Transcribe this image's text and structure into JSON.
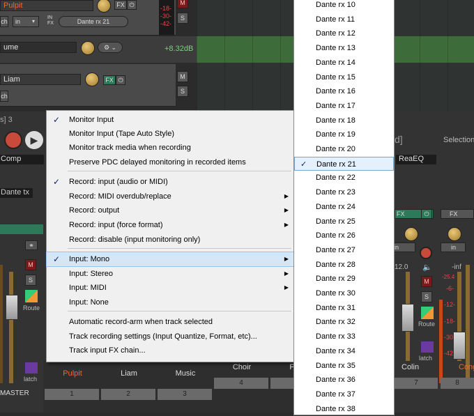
{
  "tracks": {
    "track1_name": "Pulpit",
    "track1_fx": "FX",
    "track1_in": "in",
    "track1_arch": "ch",
    "track1_infx": "IN\nFX",
    "track1_input": "Dante rx 21",
    "track1_meter": [
      "-18-",
      "-30-",
      "-42-"
    ],
    "volume_label": "ume",
    "volume_db": "+8.32dB",
    "track2_name": "Liam",
    "track2_fx": "FX",
    "track2_arch": "ch"
  },
  "ms": {
    "m": "M",
    "s": "S"
  },
  "left_panel": {
    "frag_a": "s] 3",
    "comp": "Comp",
    "dante_tx": "Dante tx",
    "route": "Route",
    "latch": "latch",
    "master": "MASTER"
  },
  "right_panel": {
    "frag_bracket": "d]",
    "selection": "Selection",
    "reaeq": "ReaEQ",
    "fx1": "FX",
    "fx2": "FX",
    "in1": "in",
    "in2": "in",
    "val1": "12.0",
    "val2": "-inf",
    "meter2": [
      "-25.4",
      "-6-",
      "-12-",
      "-18-",
      "-30-",
      "-42-"
    ],
    "route": "Route",
    "latch": "latch",
    "colin": "Colin",
    "cong": "Cong"
  },
  "mixer": {
    "strips": [
      {
        "label": "Pulpit",
        "num": "1",
        "color": "#f06a2a"
      },
      {
        "label": "Liam",
        "num": "2",
        "color": "#dddddd"
      },
      {
        "label": "Music",
        "num": "3",
        "color": "#dddddd"
      },
      {
        "label": "Choir",
        "num": "4",
        "color": "#dddddd"
      },
      {
        "label": "P",
        "num": "",
        "color": "#dddddd"
      },
      {
        "label": "Colin",
        "num": "7",
        "color": "#dddddd"
      },
      {
        "label": "Cong",
        "num": "8",
        "color": "#f06a2a"
      }
    ]
  },
  "context_menu": {
    "items": [
      {
        "label": "Monitor Input",
        "checked": true,
        "submenu": false
      },
      {
        "label": "Monitor Input (Tape Auto Style)",
        "checked": false,
        "submenu": false
      },
      {
        "label": "Monitor track media when recording",
        "checked": false,
        "submenu": false
      },
      {
        "label": "Preserve PDC delayed monitoring in recorded items",
        "checked": false,
        "submenu": false
      },
      {
        "label": "Record: input (audio or MIDI)",
        "checked": true,
        "submenu": false
      },
      {
        "label": "Record: MIDI overdub/replace",
        "checked": false,
        "submenu": true
      },
      {
        "label": "Record: output",
        "checked": false,
        "submenu": true
      },
      {
        "label": "Record: input (force format)",
        "checked": false,
        "submenu": true
      },
      {
        "label": "Record: disable (input monitoring only)",
        "checked": false,
        "submenu": false
      },
      {
        "label": "Input: Mono",
        "checked": true,
        "submenu": true,
        "highlighted": true
      },
      {
        "label": "Input: Stereo",
        "checked": false,
        "submenu": true
      },
      {
        "label": "Input: MIDI",
        "checked": false,
        "submenu": true
      },
      {
        "label": "Input: None",
        "checked": false,
        "submenu": false
      },
      {
        "label": "Automatic record-arm when track selected",
        "checked": false,
        "submenu": false
      },
      {
        "label": "Track recording settings (Input Quantize, Format, etc)...",
        "checked": false,
        "submenu": false
      },
      {
        "label": "Track input FX chain...",
        "checked": false,
        "submenu": false
      }
    ]
  },
  "input_list": {
    "items": [
      "Dante rx 10",
      "Dante rx 11",
      "Dante rx 12",
      "Dante rx 13",
      "Dante rx 14",
      "Dante rx 15",
      "Dante rx 16",
      "Dante rx 17",
      "Dante rx 18",
      "Dante rx 19",
      "Dante rx 20",
      "Dante rx 21",
      "Dante rx 22",
      "Dante rx 23",
      "Dante rx 24",
      "Dante rx 25",
      "Dante rx 26",
      "Dante rx 27",
      "Dante rx 28",
      "Dante rx 29",
      "Dante rx 30",
      "Dante rx 31",
      "Dante rx 32",
      "Dante rx 33",
      "Dante rx 34",
      "Dante rx 35",
      "Dante rx 36",
      "Dante rx 37",
      "Dante rx 38"
    ],
    "selected": "Dante rx 21"
  },
  "glyphs": {
    "check": "✓",
    "arrow": "▶"
  }
}
